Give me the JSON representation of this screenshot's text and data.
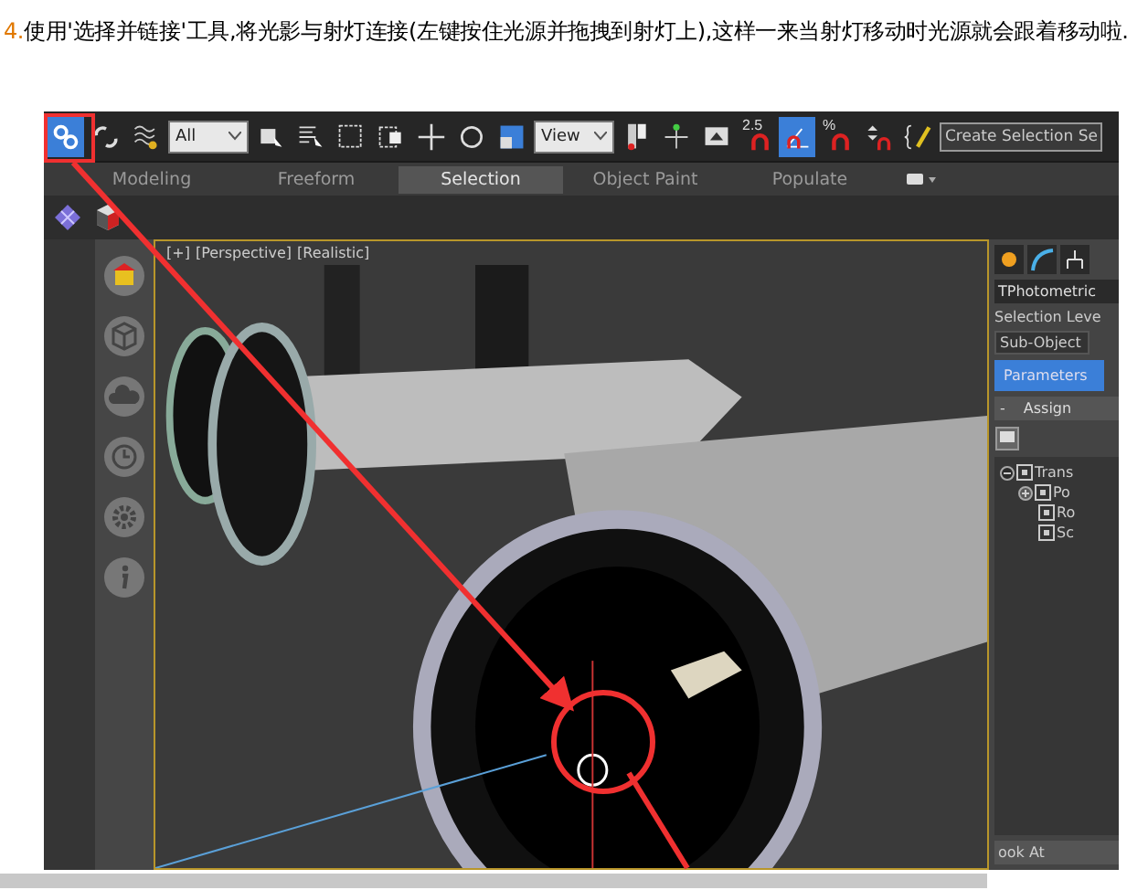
{
  "instruction": {
    "number": "4.",
    "text": "使用'选择并链接'工具,将光影与射灯连接(左键按住光源并拖拽到射灯上),这样一来当射灯移动时光源就会跟着移动啦."
  },
  "toolbar": [
    {
      "kind": "button",
      "active": true
    },
    {
      "kind": "button",
      "active": false
    },
    {
      "kind": "button",
      "active": false
    },
    {
      "kind": "dropdown",
      "value": "All"
    },
    {
      "kind": "button",
      "active": false
    },
    {
      "kind": "button",
      "active": false
    },
    {
      "kind": "button",
      "active": false
    },
    {
      "kind": "button",
      "active": false
    },
    {
      "kind": "button",
      "active": false
    },
    {
      "kind": "button",
      "active": false
    },
    {
      "kind": "button",
      "active": false
    },
    {
      "kind": "dropdown",
      "value": "View"
    },
    {
      "kind": "button",
      "active": false
    },
    {
      "kind": "button",
      "active": false
    },
    {
      "kind": "button",
      "active": false
    },
    {
      "kind": "snap",
      "label": "2.5",
      "active": false
    },
    {
      "kind": "button",
      "active": true
    },
    {
      "kind": "snap",
      "label": "%",
      "active": false
    },
    {
      "kind": "button",
      "active": false
    },
    {
      "kind": "button",
      "active": false
    },
    {
      "kind": "field",
      "value": "Create Selection Se"
    }
  ],
  "ribbon_tabs": [
    {
      "label": "Modeling",
      "selected": false
    },
    {
      "label": "Freeform",
      "selected": false
    },
    {
      "label": "Selection",
      "selected": true
    },
    {
      "label": "Object Paint",
      "selected": false
    },
    {
      "label": "Populate",
      "selected": false
    }
  ],
  "viewport_labels": [
    "[+]",
    "[Perspective]",
    "[Realistic]"
  ],
  "command_panel": {
    "object_name": "TPhotometric",
    "selection_level_label": "Selection Leve",
    "sub_object_button": "Sub-Object",
    "parameters_button": "Parameters",
    "rollout": {
      "toggle": "-",
      "title": "Assign"
    },
    "tree": [
      {
        "label": "Trans",
        "kind": "group",
        "expanded": true,
        "children": [
          {
            "label": "Po",
            "kind": "group",
            "expanded": false
          },
          {
            "label": "Ro",
            "kind": "leaf"
          },
          {
            "label": "Sc",
            "kind": "leaf"
          }
        ]
      }
    ],
    "bottom_button": "ook At"
  }
}
